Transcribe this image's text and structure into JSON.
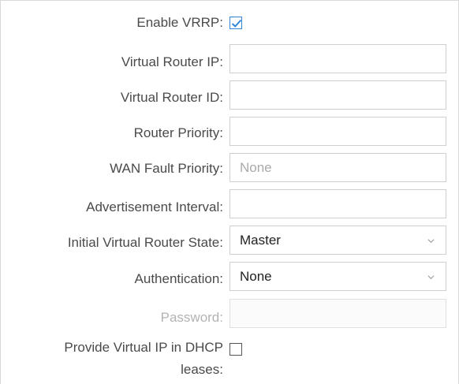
{
  "form": {
    "enable_vrrp": {
      "label": "Enable VRRP:",
      "checked": true
    },
    "virtual_router_ip": {
      "label": "Virtual Router IP:",
      "value": ""
    },
    "virtual_router_id": {
      "label": "Virtual Router ID:",
      "value": ""
    },
    "router_priority": {
      "label": "Router Priority:",
      "value": ""
    },
    "wan_fault_priority": {
      "label": "WAN Fault Priority:",
      "placeholder": "None"
    },
    "advertisement_interval": {
      "label": "Advertisement Interval:",
      "value": ""
    },
    "initial_state": {
      "label": "Initial Virtual Router State:",
      "selected": "Master"
    },
    "authentication": {
      "label": "Authentication:",
      "selected": "None"
    },
    "password": {
      "label": "Password:",
      "value": "",
      "disabled": true
    },
    "dhcp_virtual_ip": {
      "label_line1": "Provide Virtual IP in DHCP",
      "label_line2": "leases:",
      "checked": false
    }
  },
  "colors": {
    "accent": "#2f86d6",
    "label_text": "#4a4a4a",
    "disabled_text": "#b3b3b3",
    "border": "#cfcfcf"
  },
  "icons": {
    "checkmark": "checkmark-icon",
    "dropdown": "chevron-down-icon"
  }
}
